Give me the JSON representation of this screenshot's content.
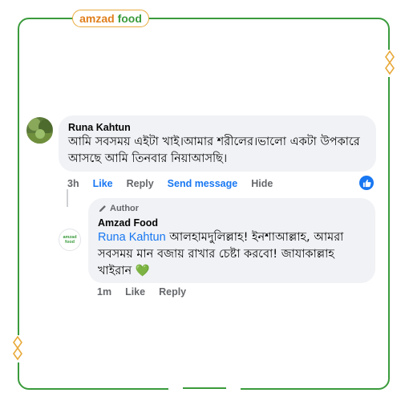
{
  "brand": {
    "part1": "amzad",
    "part2": "food",
    "green": "#3a9b3c",
    "orange": "#e07e1b"
  },
  "comment": {
    "author": "Runa Kahtun",
    "text": "আমি সবসময় এইটা খাই।আমার শরীলের।ভালো একটা উপকারে আসছে আমি তিনবার নিয়াআসছি।",
    "time": "3h",
    "actions": {
      "like": "Like",
      "reply": "Reply",
      "send": "Send message",
      "hide": "Hide"
    },
    "reaction_icon": "thumbs-up-icon"
  },
  "reply": {
    "badge": "Author",
    "author": "Amzad Food",
    "mention": "Runa Kahtun",
    "text": " আলহামদুলিল্লাহ! ইনশাআল্লাহ, আমরা সবসময় মান বজায় রাখার চেষ্টা করবো! জাযাকাল্লাহ খাইরান",
    "emoji": "💚",
    "time": "1m",
    "actions": {
      "like": "Like",
      "reply": "Reply"
    },
    "avatar_text": "amzad food"
  },
  "colors": {
    "bubble": "#f0f2f5",
    "link": "#1877f2",
    "meta": "#65676b"
  }
}
